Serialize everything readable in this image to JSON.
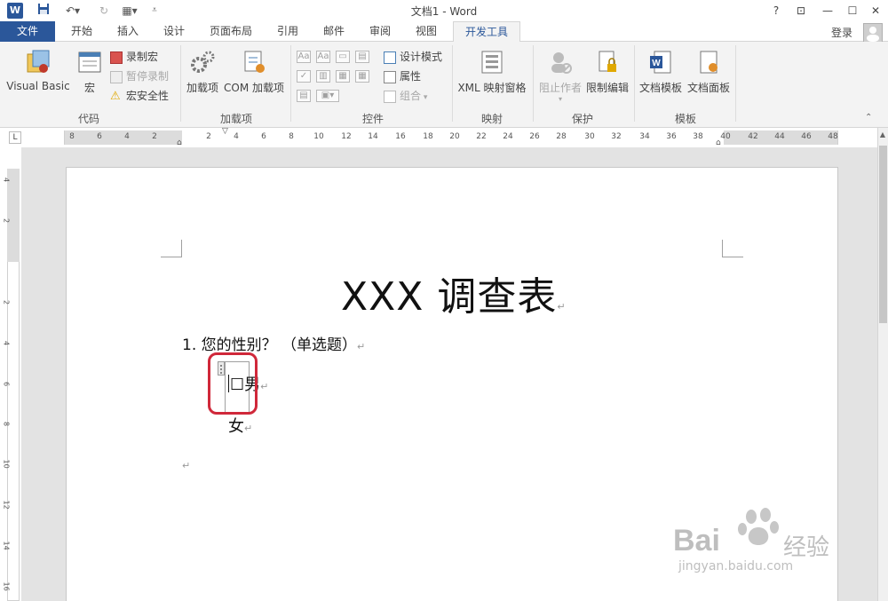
{
  "titlebar": {
    "title": "文档1 - Word",
    "help": "?",
    "restore_ribbon": "⊡",
    "minimize": "—",
    "maximize": "☐",
    "close": "✕"
  },
  "tabs": {
    "file": "文件",
    "items": [
      "开始",
      "插入",
      "设计",
      "页面布局",
      "引用",
      "邮件",
      "审阅",
      "视图",
      "开发工具"
    ],
    "active_index": 8,
    "login": "登录"
  },
  "ribbon": {
    "code": {
      "label": "代码",
      "visual_basic": "Visual Basic",
      "macro": "宏",
      "record_macro": "录制宏",
      "pause_record": "暂停录制",
      "macro_security": "宏安全性"
    },
    "addins": {
      "label": "加载项",
      "addin": "加载项",
      "com_addin": "COM 加载项"
    },
    "controls": {
      "label": "控件",
      "design_mode": "设计模式",
      "properties": "属性",
      "group": "组合"
    },
    "mapping": {
      "label": "映射",
      "xml_pane": "XML 映射窗格"
    },
    "protect": {
      "label": "保护",
      "block_authors": "阻止作者",
      "restrict_editing": "限制编辑"
    },
    "templates": {
      "label": "模板",
      "doc_template": "文档模板",
      "doc_panel": "文档面板"
    }
  },
  "ruler": {
    "corner": "L",
    "h_left": [
      "8",
      "6",
      "4",
      "2"
    ],
    "h_right": [
      "2",
      "4",
      "6",
      "8",
      "10",
      "12",
      "14",
      "16",
      "18",
      "20",
      "22",
      "24",
      "26",
      "28",
      "30",
      "32",
      "34",
      "36",
      "38",
      "40",
      "42",
      "44",
      "46",
      "48"
    ],
    "v_top": [
      "4",
      "2"
    ],
    "v_body": [
      "2",
      "4",
      "6",
      "8",
      "10",
      "12",
      "14",
      "16"
    ]
  },
  "document": {
    "title": "XXX 调查表",
    "question1": "1. 您的性别？  （单选题）",
    "option_male": "☐男",
    "option_female": "女",
    "pilcrow": "↵"
  },
  "watermark": {
    "brand": "Bai",
    "brand_tail": "经验",
    "url": "jingyan.baidu.com"
  },
  "colors": {
    "accent": "#2b579a",
    "highlight_box": "#d0283a"
  }
}
